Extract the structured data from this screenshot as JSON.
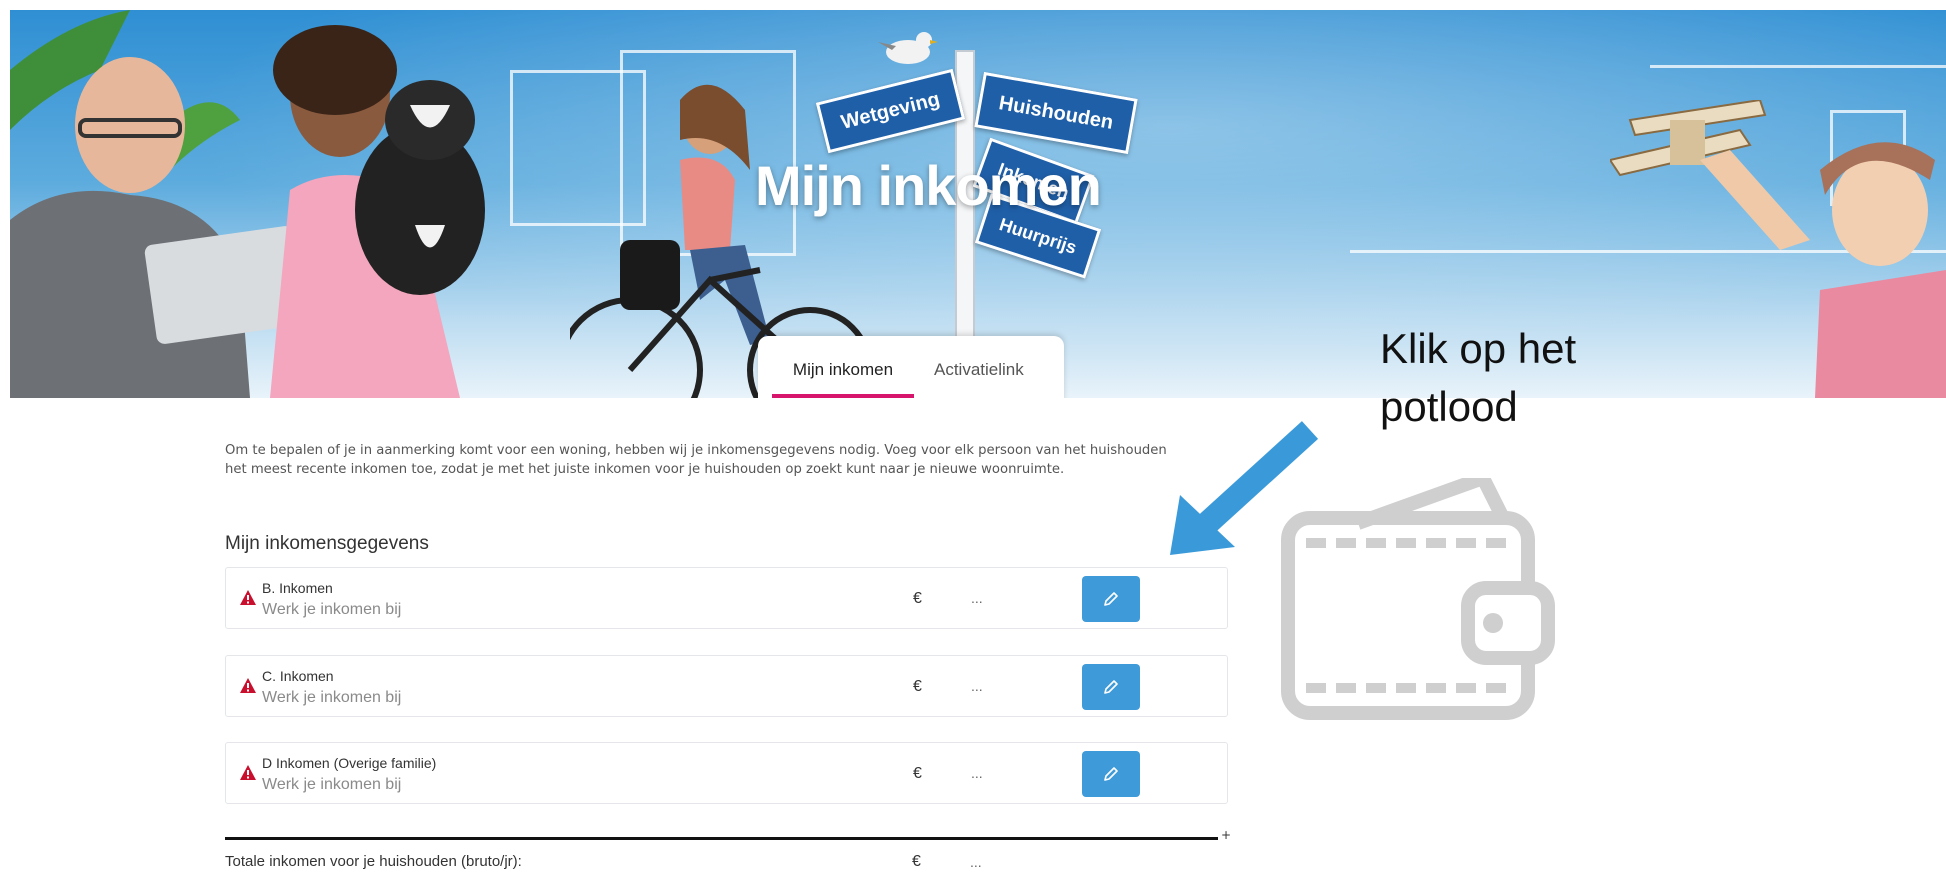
{
  "hero": {
    "title": "Mijn inkomen",
    "signs": [
      "Wetgeving",
      "Huishouden",
      "Inkomen",
      "Huurprijs"
    ]
  },
  "tabs": [
    {
      "label": "Mijn inkomen",
      "active": true
    },
    {
      "label": "Activatielink",
      "active": false
    }
  ],
  "annotation": {
    "text_line1": "Klik op het",
    "text_line2": "potlood"
  },
  "intro": "Om te bepalen of je in aanmerking komt voor een woning, hebben wij je inkomensgegevens nodig. Voeg voor elk persoon van het huishouden het meest recente inkomen toe, zodat je met het juiste inkomen voor je huishouden op zoekt kunt naar je nieuwe woonruimte.",
  "section_title": "Mijn inkomensgegevens",
  "rows": [
    {
      "name": "B. Inkomen",
      "sub": "Werk je inkomen bij",
      "currency": "€",
      "value": "..."
    },
    {
      "name": "C. Inkomen",
      "sub": "Werk je inkomen bij",
      "currency": "€",
      "value": "..."
    },
    {
      "name": "D Inkomen (Overige familie)",
      "sub": "Werk je inkomen bij",
      "currency": "€",
      "value": "..."
    }
  ],
  "total": {
    "label": "Totale inkomen voor je huishouden (bruto/jr):",
    "currency": "€",
    "value": "...",
    "plus": "+"
  },
  "icons": {
    "warning": "warning-triangle-icon",
    "edit": "pencil-icon",
    "wallet": "wallet-icon",
    "arrow": "arrow-pointer"
  },
  "colors": {
    "accent": "#3e9ad8",
    "tab_underline": "#d8156c",
    "warning": "#c8102e",
    "arrow": "#3a9ad9"
  }
}
